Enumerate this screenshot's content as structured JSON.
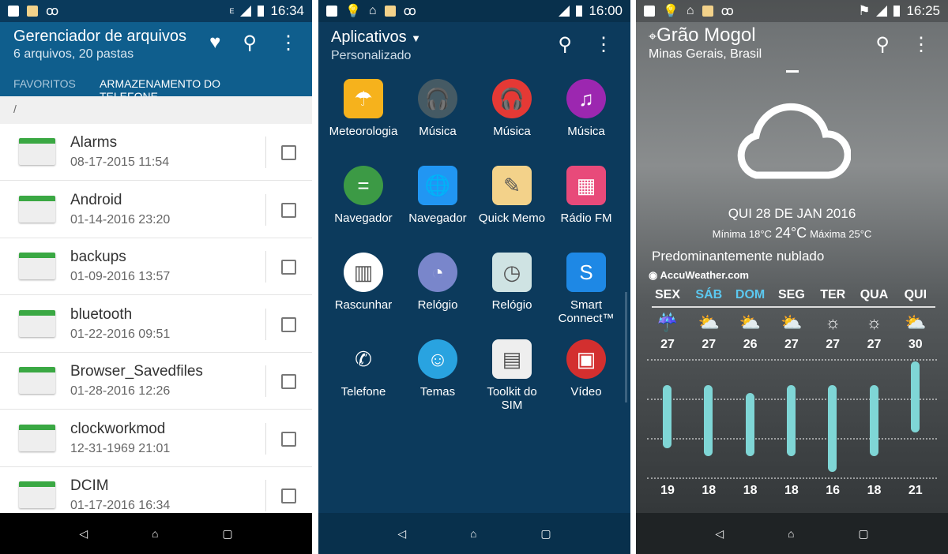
{
  "file_manager": {
    "status": {
      "time": "16:34",
      "network": "E"
    },
    "title": "Gerenciador de arquivos",
    "subtitle": "6 arquivos, 20 pastas",
    "tabs": [
      "FAVORITOS",
      "ARMAZENAMENTO DO TELEFONE"
    ],
    "active_tab": 1,
    "path": "/",
    "items": [
      {
        "name": "Alarms",
        "date": "08-17-2015 11:54"
      },
      {
        "name": "Android",
        "date": "01-14-2016 23:20"
      },
      {
        "name": "backups",
        "date": "01-09-2016 13:57"
      },
      {
        "name": "bluetooth",
        "date": "01-22-2016 09:51"
      },
      {
        "name": "Browser_Savedfiles",
        "date": "01-28-2016 12:26"
      },
      {
        "name": "clockworkmod",
        "date": "12-31-1969 21:01"
      },
      {
        "name": "DCIM",
        "date": "01-17-2016 16:34"
      }
    ]
  },
  "app_drawer": {
    "status": {
      "time": "16:00"
    },
    "title": "Aplicativos",
    "subtitle": "Personalizado",
    "apps": [
      {
        "label": "Meteorologia",
        "color": "#f6b21c",
        "glyph": "☂"
      },
      {
        "label": "Música",
        "color": "#455a64",
        "glyph": "🎧"
      },
      {
        "label": "Música",
        "color": "#e53935",
        "glyph": "🎧"
      },
      {
        "label": "Música",
        "color": "#9c27b0",
        "glyph": "♫"
      },
      {
        "label": "Navegador",
        "color": "#3c9a45",
        "glyph": "="
      },
      {
        "label": "Navegador",
        "color": "#2196f3",
        "glyph": "🌐"
      },
      {
        "label": "Quick Memo",
        "color": "#f3d28a",
        "glyph": "✎"
      },
      {
        "label": "Rádio FM",
        "color": "#e84a7a",
        "glyph": "▦"
      },
      {
        "label": "Rascunhar",
        "color": "#ffffff",
        "glyph": "▥"
      },
      {
        "label": "Relógio",
        "color": "#7986cb",
        "glyph": "◔"
      },
      {
        "label": "Relógio",
        "color": "#cfe3e3",
        "glyph": "◷"
      },
      {
        "label": "Smart Connect™",
        "color": "#1e88e5",
        "glyph": "S"
      },
      {
        "label": "Telefone",
        "color": "#0c3a5c",
        "glyph": "✆"
      },
      {
        "label": "Temas",
        "color": "#29a3e0",
        "glyph": "☺"
      },
      {
        "label": "Toolkit do SIM",
        "color": "#eeeeee",
        "glyph": "▤"
      },
      {
        "label": "Vídeo",
        "color": "#d32f2f",
        "glyph": "▣"
      }
    ]
  },
  "weather": {
    "status": {
      "time": "16:25"
    },
    "city": "Grão Mogol",
    "region": "Minas Gerais, Brasil",
    "date": "QUI 28 DE JAN 2016",
    "min": "Mínima 18°C",
    "current": "24°C",
    "max": "Máxima 25°C",
    "condition": "Predominantemente nublado",
    "provider": "AccuWeather.com",
    "weekend_color": "#5bc8f0",
    "chart_data": {
      "type": "range-bar",
      "categories": [
        "SEX",
        "SÁB",
        "DOM",
        "SEG",
        "TER",
        "QUA",
        "QUI"
      ],
      "icons": [
        "rain-cloud",
        "partly-cloudy",
        "partly-cloudy",
        "partly-cloudy",
        "sunny",
        "sunny",
        "partly-cloudy"
      ],
      "series": [
        {
          "name": "max",
          "values": [
            27,
            27,
            26,
            27,
            27,
            27,
            30
          ]
        },
        {
          "name": "min",
          "values": [
            19,
            18,
            18,
            18,
            16,
            18,
            21
          ]
        }
      ]
    }
  }
}
